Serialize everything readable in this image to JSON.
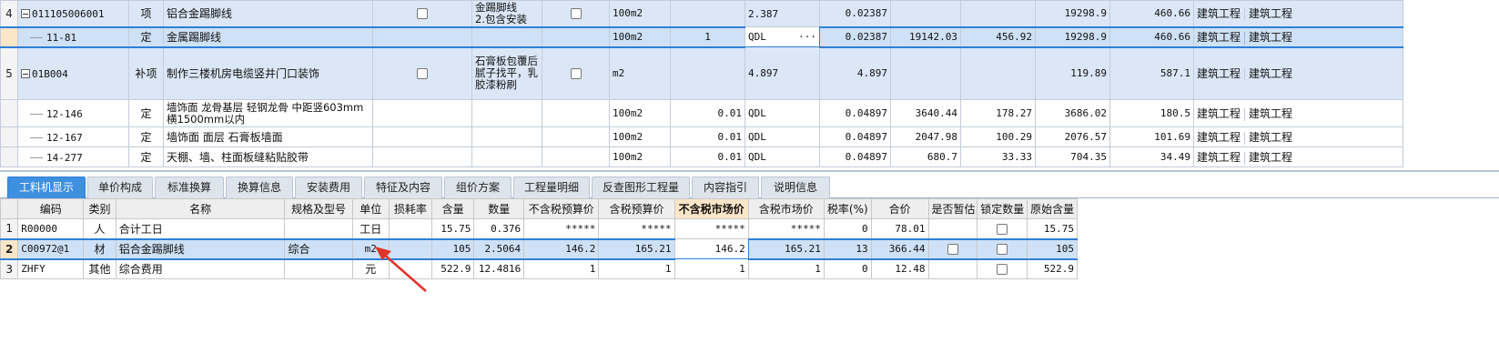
{
  "top_rows": [
    {
      "num": "4",
      "code": "011105006001",
      "type": "项",
      "name": "铝合金踢脚线",
      "desc": "金踢脚线\n2.包含安装",
      "unit": "100m2",
      "qty": "",
      "expr": "2.387",
      "val": "0.02387",
      "p1": "",
      "p2": "",
      "p3": "19298.9",
      "p4": "460.66",
      "cat1": "建筑工程",
      "cat2": "建筑工程"
    },
    {
      "num": "",
      "code": "11-81",
      "type": "定",
      "name": "金属踢脚线",
      "desc": "",
      "unit": "100m2",
      "qty": "1",
      "expr": "QDL",
      "val": "0.02387",
      "p1": "19142.03",
      "p2": "456.92",
      "p3": "19298.9",
      "p4": "460.66",
      "cat1": "建筑工程",
      "cat2": "建筑工程"
    },
    {
      "num": "5",
      "code": "01B004",
      "type": "补项",
      "name": "制作三楼机房电缆竖井门口装饰",
      "desc": "石膏板包覆后腻子找平，乳胶漆粉刷",
      "unit": "m2",
      "qty": "",
      "expr": "4.897",
      "val": "4.897",
      "p1": "",
      "p2": "",
      "p3": "119.89",
      "p4": "587.1",
      "cat1": "建筑工程",
      "cat2": "建筑工程"
    },
    {
      "num": "",
      "code": "12-146",
      "type": "定",
      "name": "墙饰面 龙骨基层 轻钢龙骨 中距竖603mm 横1500mm以内",
      "desc": "",
      "unit": "100m2",
      "qty": "0.01",
      "expr": "QDL",
      "val": "0.04897",
      "p1": "3640.44",
      "p2": "178.27",
      "p3": "3686.02",
      "p4": "180.5",
      "cat1": "建筑工程",
      "cat2": "建筑工程"
    },
    {
      "num": "",
      "code": "12-167",
      "type": "定",
      "name": "墙饰面 面层 石膏板墙面",
      "desc": "",
      "unit": "100m2",
      "qty": "0.01",
      "expr": "QDL",
      "val": "0.04897",
      "p1": "2047.98",
      "p2": "100.29",
      "p3": "2076.57",
      "p4": "101.69",
      "cat1": "建筑工程",
      "cat2": "建筑工程"
    },
    {
      "num": "",
      "code": "14-277",
      "type": "定",
      "name": "天棚、墙、柱面板缝粘贴胶带",
      "desc": "",
      "unit": "100m2",
      "qty": "0.01",
      "expr": "QDL",
      "val": "0.04897",
      "p1": "680.7",
      "p2": "33.33",
      "p3": "704.35",
      "p4": "34.49",
      "cat1": "建筑工程",
      "cat2": "建筑工程"
    }
  ],
  "edit_ellipsis": "···",
  "tabs": [
    "工料机显示",
    "单价构成",
    "标准换算",
    "换算信息",
    "安装费用",
    "特征及内容",
    "组价方案",
    "工程量明细",
    "反查图形工程量",
    "内容指引",
    "说明信息"
  ],
  "bottom_headers": [
    "",
    "编码",
    "类别",
    "名称",
    "规格及型号",
    "单位",
    "损耗率",
    "含量",
    "数量",
    "不含税预算价",
    "含税预算价",
    "不含税市场价",
    "含税市场价",
    "税率(%)",
    "合价",
    "是否暂估",
    "锁定数量",
    "原始含量"
  ],
  "bottom_rows": [
    {
      "num": "1",
      "code": "R00000",
      "type": "人",
      "name": "合计工日",
      "spec": "",
      "unit": "工日",
      "loss": "",
      "content": "15.75",
      "qty": "0.376",
      "p1": "*****",
      "p2": "*****",
      "p3": "*****",
      "p4": "*****",
      "tax": "0",
      "total": "78.01",
      "est": false,
      "lock": true,
      "orig": "15.75"
    },
    {
      "num": "2",
      "code": "C00972@1",
      "type": "材",
      "name": "铝合金踢脚线",
      "spec": "综合",
      "unit": "m2",
      "loss": "",
      "content": "105",
      "qty": "2.5064",
      "p1": "146.2",
      "p2": "165.21",
      "p3": "146.2",
      "p4": "165.21",
      "tax": "13",
      "total": "366.44",
      "est": true,
      "lock": true,
      "orig": "105"
    },
    {
      "num": "3",
      "code": "ZHFY",
      "type": "其他",
      "name": "综合费用",
      "spec": "",
      "unit": "元",
      "loss": "",
      "content": "522.9",
      "qty": "12.4816",
      "p1": "1",
      "p2": "1",
      "p3": "1",
      "p4": "1",
      "tax": "0",
      "total": "12.48",
      "est": false,
      "lock": true,
      "orig": "522.9"
    }
  ],
  "colors": {
    "accent": "#3d8fe0",
    "selection": "#cfe1f6",
    "highlight_header": "#fbe6c8",
    "arrow": "#e0342b"
  }
}
